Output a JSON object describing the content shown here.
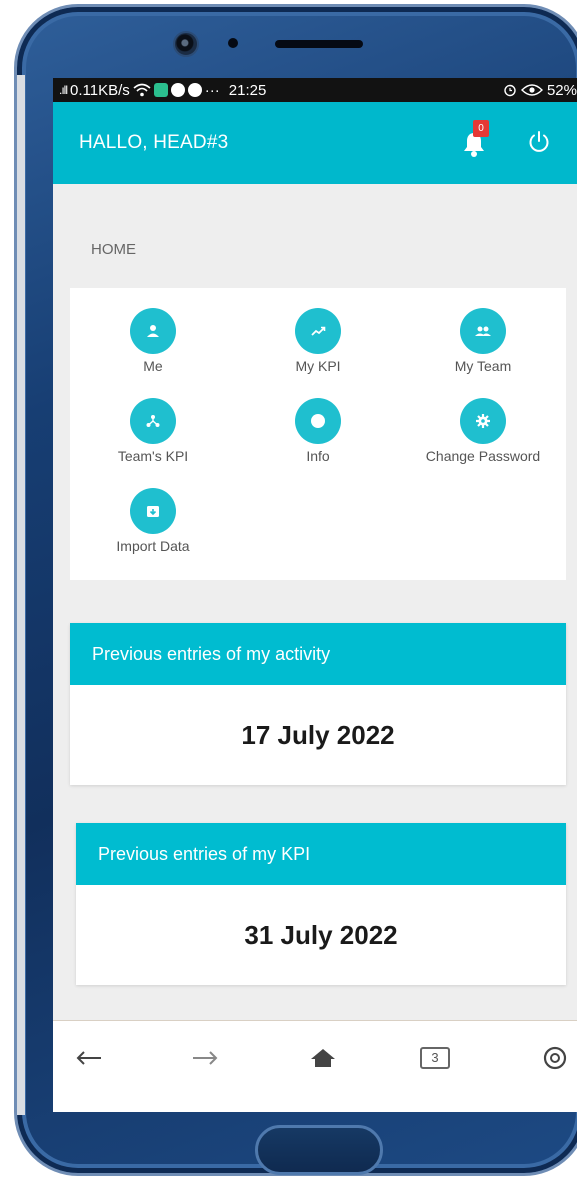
{
  "status_bar": {
    "speed": "0.11KB/s",
    "time": "21:25",
    "more": "···",
    "battery": "52%"
  },
  "header": {
    "greeting": "HALLO, HEAD#3",
    "notification_count": "0"
  },
  "home": {
    "title": "HOME",
    "items": [
      {
        "label": "Me",
        "icon": "person-icon"
      },
      {
        "label": "My KPI",
        "icon": "trending-up-icon"
      },
      {
        "label": "My Team",
        "icon": "group-icon"
      },
      {
        "label": "Team's KPI",
        "icon": "hierarchy-icon"
      },
      {
        "label": "Info",
        "icon": "circle-icon"
      },
      {
        "label": "Change Password",
        "icon": "gear-icon"
      },
      {
        "label": "Import Data",
        "icon": "import-box-icon"
      }
    ]
  },
  "entries": [
    {
      "title": "Previous entries of my activity",
      "date": "17 July 2022"
    },
    {
      "title": "Previous entries of my KPI",
      "date": "31 July 2022"
    }
  ],
  "browser_nav": {
    "tab_count": "3"
  },
  "colors": {
    "primary": "#00b8cc",
    "icon_circle": "#1fbfcf",
    "badge": "#e53935",
    "background": "#eeeeee"
  }
}
